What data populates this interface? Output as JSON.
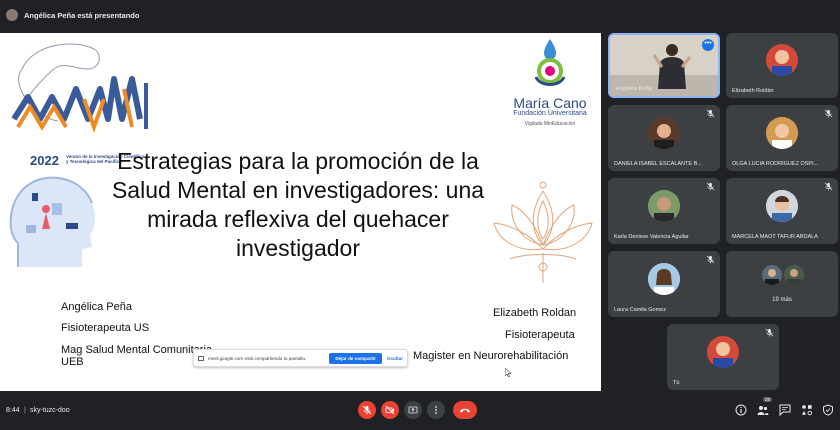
{
  "topbar": {
    "presenting_text": "Angélica Peña está presentando"
  },
  "slide": {
    "event_year": "2022",
    "event_subtitle": "Verano de la Investigación Científica y Tecnológica del Pacífico",
    "org_name": "María Cano",
    "org_subtitle": "Fundación Universitaria",
    "org_supervision": "Vigilada MinEducación",
    "title_lines": [
      "Estrategias para la promoción de la",
      "Salud Mental en investigadores: una",
      "mirada reflexiva del quehacer",
      "investigador"
    ],
    "speaker_left": [
      "Angélica Peña",
      "Fisioterapeuta US",
      "Mag Salud Mental Comunitaria",
      "UEB"
    ],
    "speaker_right": [
      "Elizabeth Roldan",
      "Fisioterapeuta",
      "Magister en Neurorehabilitación"
    ]
  },
  "share_notice": {
    "text": "meet.google.com está compartiendo tu pantalla.",
    "stop_label": "Dejar de compartir",
    "hide_label": "Ocultar"
  },
  "participants": [
    {
      "name": "Angélica Peña",
      "pinned": true
    },
    {
      "name": "Elizabeth Roldán"
    },
    {
      "name": "DANIELA ISABEL ESCALANTE B..."
    },
    {
      "name": "OLGA LUCIA RODRIGUEZ OSPI..."
    },
    {
      "name": "Karla Denisse Valencia Aguilar"
    },
    {
      "name": "MARCELA MAOT TAFUR ABDALA"
    },
    {
      "name": "Laura Camila Gomez"
    },
    {
      "name": "19 más"
    },
    {
      "name": "Tú"
    }
  ],
  "bottombar": {
    "time": "8:44",
    "separator": "|",
    "meeting_code": "sky-tuzc-doo",
    "participant_count": "28"
  },
  "colors": {
    "background": "#202124",
    "tile": "#3c4043",
    "danger": "#ea4335",
    "accent": "#1a73e8"
  }
}
